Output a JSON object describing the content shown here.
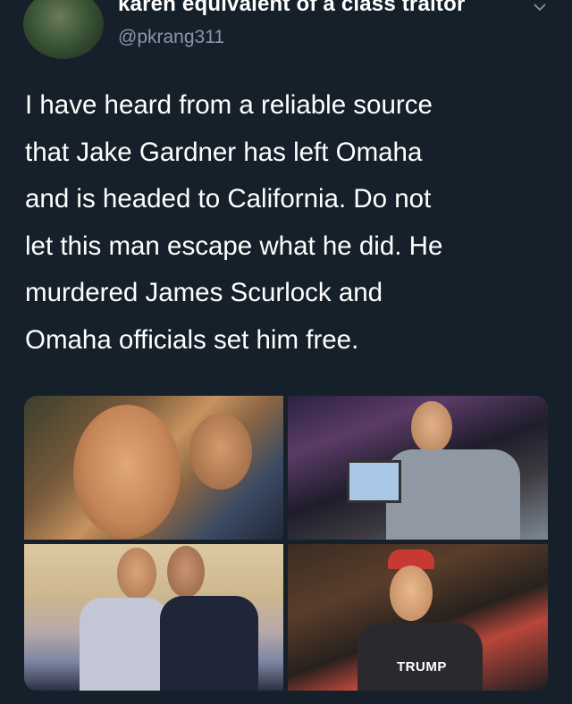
{
  "author": {
    "display_name": "karen equivalent of a class traitor",
    "handle": "@pkrang311",
    "avatar_icon": "profile-photo"
  },
  "menu": {
    "icon": "chevron-down-icon"
  },
  "tweet": {
    "text": "I have heard from a reliable source\nthat Jake Gardner has left Omaha\nand is headed to California. Do not\nlet this man escape what he did. He\nmurdered James Scurlock and\nOmaha officials set him free."
  },
  "media": {
    "photos": [
      {
        "description_icon": "photo"
      },
      {
        "description_icon": "photo"
      },
      {
        "description_icon": "photo"
      },
      {
        "description_icon": "photo",
        "shirt_text": "TRUMP"
      }
    ]
  },
  "colors": {
    "background": "#15202b",
    "text": "#ffffff",
    "secondary_text": "#8899a6"
  }
}
